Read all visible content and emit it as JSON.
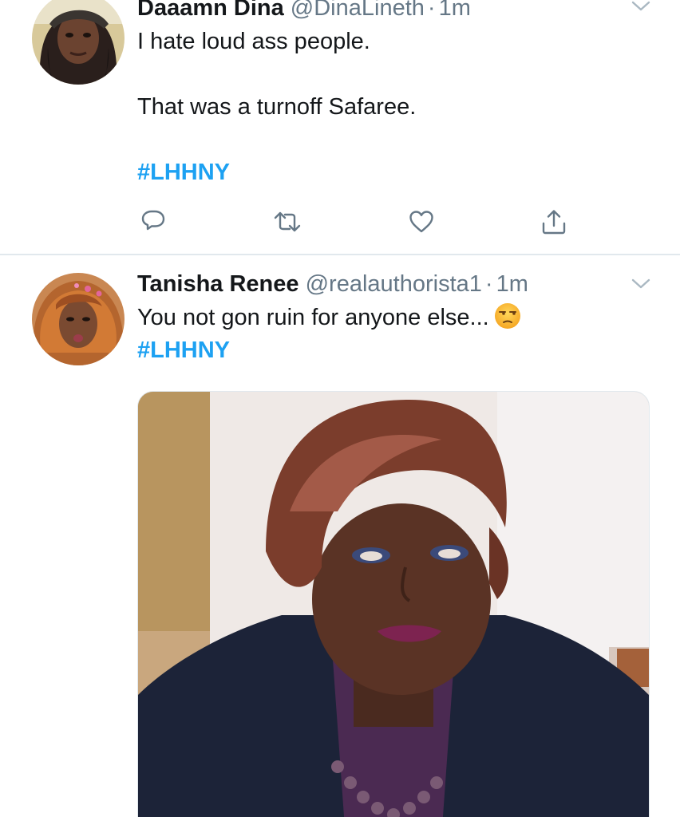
{
  "tweets": [
    {
      "display_name": "Daaamn Dina",
      "handle": "@DinaLineth",
      "separator": "·",
      "time": "1m",
      "text_lines": [
        "I hate loud ass people.",
        "That was a turnoff Safaree."
      ],
      "hashtag": "#LHHNY",
      "icons": {
        "avatar": "avatar-photo",
        "menu": "chevron-down-icon",
        "reply": "reply-icon",
        "retweet": "retweet-icon",
        "like": "heart-icon",
        "share": "share-icon"
      }
    },
    {
      "display_name": "Tanisha Renee",
      "handle": "@realauthorista1",
      "separator": "·",
      "time": "1m",
      "text": "You not gon ruin for anyone else...",
      "emoji": "unamused-face-emoji",
      "hashtag": "#LHHNY",
      "media": "gif-woman-rolling-eyes",
      "icons": {
        "avatar": "avatar-photo",
        "menu": "chevron-down-icon"
      }
    }
  ],
  "colors": {
    "link": "#1da1f2",
    "secondary_text": "#657786",
    "icon": "#657786",
    "divider": "#e1e8ed"
  }
}
